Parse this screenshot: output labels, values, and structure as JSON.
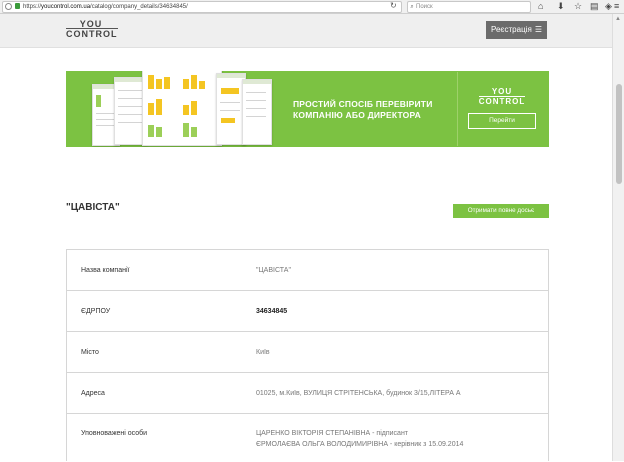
{
  "browser": {
    "url_prefix": "https://",
    "url_domain": "youcontrol.com.ua",
    "url_path": "/catalog/company_details/34634845/",
    "search_placeholder": "Поиск",
    "reload_glyph": "↻",
    "toolbar_icons": [
      "home-icon",
      "download-icon",
      "bookmark-star-icon",
      "reading-list-icon",
      "shield-icon",
      "menu-icon"
    ]
  },
  "header": {
    "logo_line1": "YOU",
    "logo_line2": "CONTROL",
    "register_label": "Реєстрація",
    "menu_glyph": "☰"
  },
  "banner": {
    "headline": "ПРОСТИЙ СПОСІБ ПЕРЕВІРИТИ КОМПАНІЮ АБО ДИРЕКТОРА",
    "logo_line1": "YOU",
    "logo_line2": "CONTROL",
    "button_label": "Перейти",
    "color": "#7cc242"
  },
  "company": {
    "title": "\"ЦАВІСТА\"",
    "dossier_button": "Отримати повне досьє"
  },
  "details": {
    "name_label": "Назва компанії",
    "name_value": "\"ЦАВІСТА\"",
    "edrpou_label": "ЄДРПОУ",
    "edrpou_value": "34634845",
    "city_label": "Місто",
    "city_value": "Київ",
    "address_label": "Адреса",
    "address_value": "01025, м.Київ, ВУЛИЦЯ СТРІТЕНСЬКА, будинок 3/15,ЛІТЕРА А",
    "persons_label": "Уповноважені особи",
    "person1": "ЦАРЕНКО ВІКТОРІЯ СТЕПАНІВНА - підписант",
    "person2": "ЄРМОЛАЄВА ОЛЬГА ВОЛОДИМИРІВНА - керівник з 15.09.2014"
  }
}
